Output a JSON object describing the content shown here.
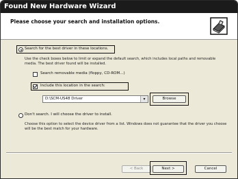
{
  "window": {
    "title": "Found New Hardware Wizard"
  },
  "header": {
    "heading": "Please choose your search and installation options."
  },
  "options": {
    "search_label": "Search for the best driver in these locations.",
    "search_desc": "Use the check boxes below to limit or expand the default search, which includes local paths and removable media. The best driver found will be installed.",
    "removable_label": "Search removable media (floppy, CD-ROM...)",
    "include_label": "Include this location in the search:",
    "location_value": "D:\\SCM-US48 Driver",
    "browse_label": "Browse",
    "dont_search_label": "Don't search. I will choose the driver to install.",
    "dont_search_desc": "Choose this option to select the device driver from a list. Windows does not guarantee that the driver you choose will be the best match for your hardware."
  },
  "footer": {
    "back_label": "< Back",
    "next_label": "Next >",
    "cancel_label": "Cancel"
  }
}
